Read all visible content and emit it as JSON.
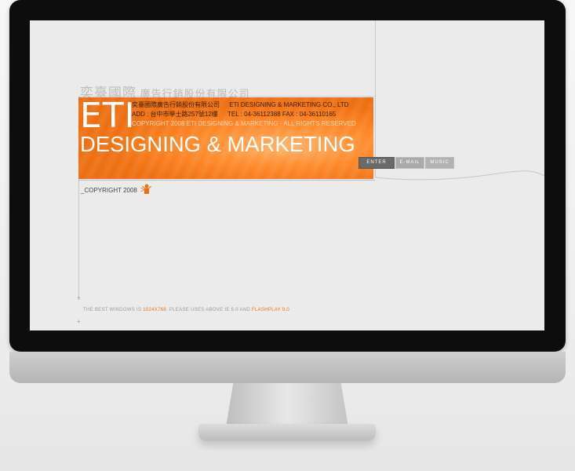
{
  "header": {
    "company_cn_main": "奕臺國際",
    "company_cn_sub": "廣告行銷股份有限公司"
  },
  "banner": {
    "eti": "ETI",
    "tagline": "DESIGNING & MARKETING",
    "info_cn": "奕臺國際廣告行銷股份有限公司",
    "info_en": "ETI DESIGNING & MARKETING CO., LTD",
    "address": "ADD : 台中市學士路257號12樓",
    "phone": "TEL : 04-36112388    FAX : 04-36110165",
    "rights": "COPYRIGHT 2008 ETI DESIGNING & MARKETING - ALL RIGHTS RESERVED"
  },
  "nav": {
    "enter": "ENTER",
    "email": "E-MAIL",
    "music": "MUSIC"
  },
  "footer": {
    "copyright": "_COPYRIGHT 2008",
    "arrow": ">",
    "note_prefix": "THE BEST WINDOWS IS",
    "resolution": "1024X768",
    "note_middle": ". PLEASE USES ABOVE IE 6.0 AND",
    "plugin": "FLASHPLAY 9.0"
  },
  "colors": {
    "accent": "#f07010",
    "bezel": "#0d0d0d",
    "screen_bg": "#ebebeb"
  }
}
